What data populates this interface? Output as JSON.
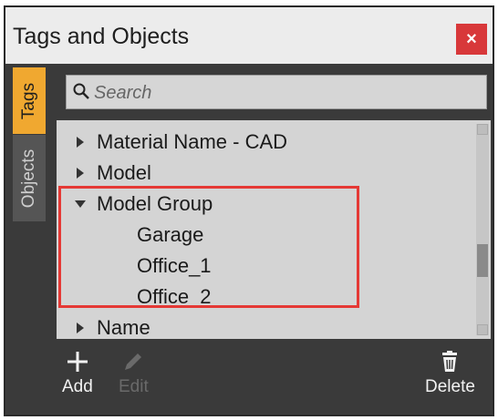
{
  "window": {
    "title": "Tags and Objects",
    "close_label": "×"
  },
  "tabs": [
    {
      "label": "Tags",
      "active": true
    },
    {
      "label": "Objects",
      "active": false
    }
  ],
  "search": {
    "placeholder": "Search",
    "value": ""
  },
  "tree": {
    "items": [
      {
        "label": "Material Name - CAD",
        "expanded": false
      },
      {
        "label": "Model",
        "expanded": false
      },
      {
        "label": "Model Group",
        "expanded": true
      },
      {
        "label": "Garage"
      },
      {
        "label": "Office_1"
      },
      {
        "label": "Office_2"
      },
      {
        "label": "Name",
        "expanded": false
      }
    ]
  },
  "toolbar": {
    "add_label": "Add",
    "edit_label": "Edit",
    "delete_label": "Delete"
  },
  "colors": {
    "accent_tab": "#f0a830",
    "close_button": "#d8383a",
    "highlight": "#e53935",
    "panel_bg": "#3a3a3a"
  },
  "icons": [
    "search-icon",
    "expand-arrow-icon",
    "collapse-arrow-icon",
    "plus-icon",
    "pencil-icon",
    "trash-icon"
  ]
}
